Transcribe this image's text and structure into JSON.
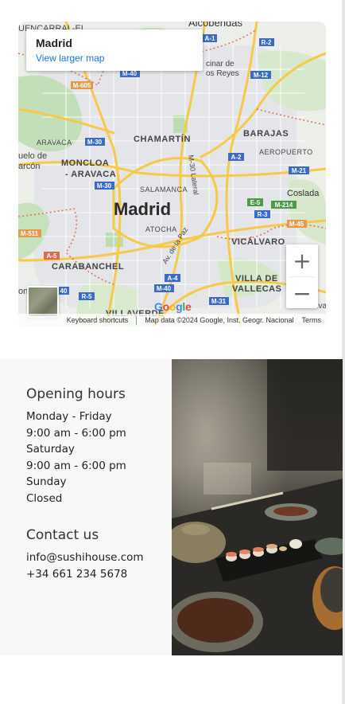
{
  "map": {
    "place_name": "Madrid",
    "larger_map_link": "View larger map",
    "zoom_in": "+",
    "zoom_out": "−",
    "google_logo": "Google",
    "attribution": {
      "shortcuts": "Keyboard shortcuts",
      "map_data": "Map data ©2024 Google, Inst. Geogr. Nacional",
      "terms": "Terms"
    },
    "labels": {
      "city": "Madrid",
      "chamartin": "CHAMARTÍN",
      "moncloa": "MONCLOA\n- ARAVACA",
      "moncloa_1": "MONCLOA",
      "moncloa_2": "- ARAVACA",
      "salamanca": "SALAMANCA",
      "atocha": "ATOCHA",
      "carabanchel": "CARABANCHEL",
      "vicalvaro": "VICÁLVARO",
      "villa_vallecas_1": "VILLA DE",
      "villa_vallecas_2": "VALLECAS",
      "villaverde": "VILLAVERDE",
      "barajas": "BARAJAS",
      "aeropuerto": "AEROPUERTO",
      "coslada": "Coslada",
      "aravaca": "ARAVACA",
      "alcobendas": "Alcobendas",
      "fuencarral": "UENCARRAL-EL",
      "pozuelo_1": "uelo de",
      "pozuelo_2": "arcón",
      "sanse_1": "cinar de",
      "sanse_2": "os Reyes",
      "m30_lateral": "M-30 Lateral",
      "av_paz": "Av. de la Paz",
      "rivas": "Rivas",
      "on": "on"
    },
    "road_shields": [
      "A-1",
      "R-2",
      "M-40",
      "M-605",
      "M-12",
      "M-30",
      "A-2",
      "M-21",
      "M-30",
      "E-5",
      "M-214",
      "R-3",
      "M-45",
      "M-511",
      "A-5",
      "A-4",
      "M-40",
      "R-5",
      "M-31",
      "40"
    ]
  },
  "opening_hours": {
    "heading": "Opening hours",
    "lines": [
      "Monday - Friday",
      "9:00 am - 6:00 pm",
      "Saturday",
      "9:00 am - 6:00 pm",
      "Sunday",
      "Closed"
    ]
  },
  "contact": {
    "heading": "Contact us",
    "email": "info@sushihouse.com",
    "phone": "+34 661 234 5678"
  },
  "colors": {
    "link": "#1a73e8",
    "section_bg": "#f8f8f8",
    "road_yellow": "#fbd160",
    "park_green": "#b9dcb0",
    "shield_blue": "#3a6cc6"
  }
}
